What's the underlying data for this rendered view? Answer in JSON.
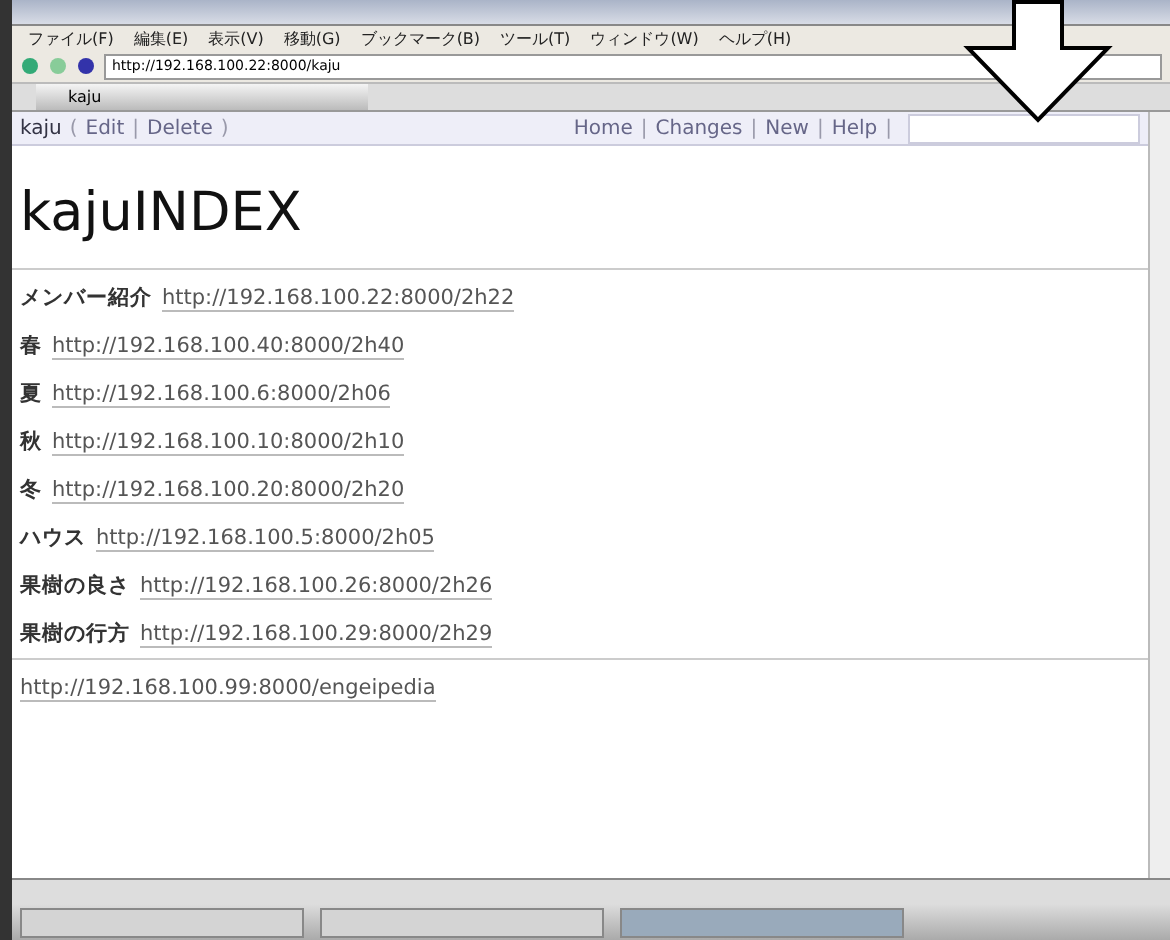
{
  "menu": [
    "ファイル(F)",
    "編集(E)",
    "表示(V)",
    "移動(G)",
    "ブックマーク(B)",
    "ツール(T)",
    "ウィンドウ(W)",
    "ヘルプ(H)"
  ],
  "address": {
    "value": "http://192.168.100.22:8000/kaju"
  },
  "tab": {
    "label": "kaju",
    "selected": true
  },
  "wiki_bar": {
    "left": [
      {
        "kind": "text",
        "text": "kaju"
      },
      {
        "kind": "punct",
        "text": "("
      },
      {
        "kind": "link",
        "text": "Edit"
      },
      {
        "kind": "punct",
        "text": "|"
      },
      {
        "kind": "link",
        "text": "Delete"
      },
      {
        "kind": "punct",
        "text": ")"
      }
    ],
    "right": [
      {
        "kind": "link",
        "text": "Home"
      },
      {
        "kind": "punct",
        "text": "|"
      },
      {
        "kind": "link",
        "text": "Changes"
      },
      {
        "kind": "punct",
        "text": "|"
      },
      {
        "kind": "link",
        "text": "New"
      },
      {
        "kind": "punct",
        "text": "|"
      },
      {
        "kind": "link",
        "text": "Help"
      },
      {
        "kind": "punct",
        "text": "|"
      }
    ]
  },
  "title": "kajuINDEX",
  "entries": [
    {
      "label": "メンバー紹介",
      "url": "http://192.168.100.22:8000/2h22"
    },
    {
      "label": "春",
      "url": "http://192.168.100.40:8000/2h40"
    },
    {
      "label": "夏",
      "url": "http://192.168.100.6:8000/2h06"
    },
    {
      "label": "秋",
      "url": "http://192.168.100.10:8000/2h10"
    },
    {
      "label": "冬",
      "url": "http://192.168.100.20:8000/2h20"
    },
    {
      "label": "ハウス",
      "url": "http://192.168.100.5:8000/2h05"
    },
    {
      "label": "果樹の良さ",
      "url": "http://192.168.100.26:8000/2h26"
    },
    {
      "label": "果樹の行方",
      "url": "http://192.168.100.29:8000/2h29"
    }
  ],
  "footer_link": "http://192.168.100.99:8000/engeipedia",
  "taskbar": {
    "windows": [
      {
        "selected": false
      },
      {
        "selected": false
      },
      {
        "selected": true
      }
    ]
  }
}
